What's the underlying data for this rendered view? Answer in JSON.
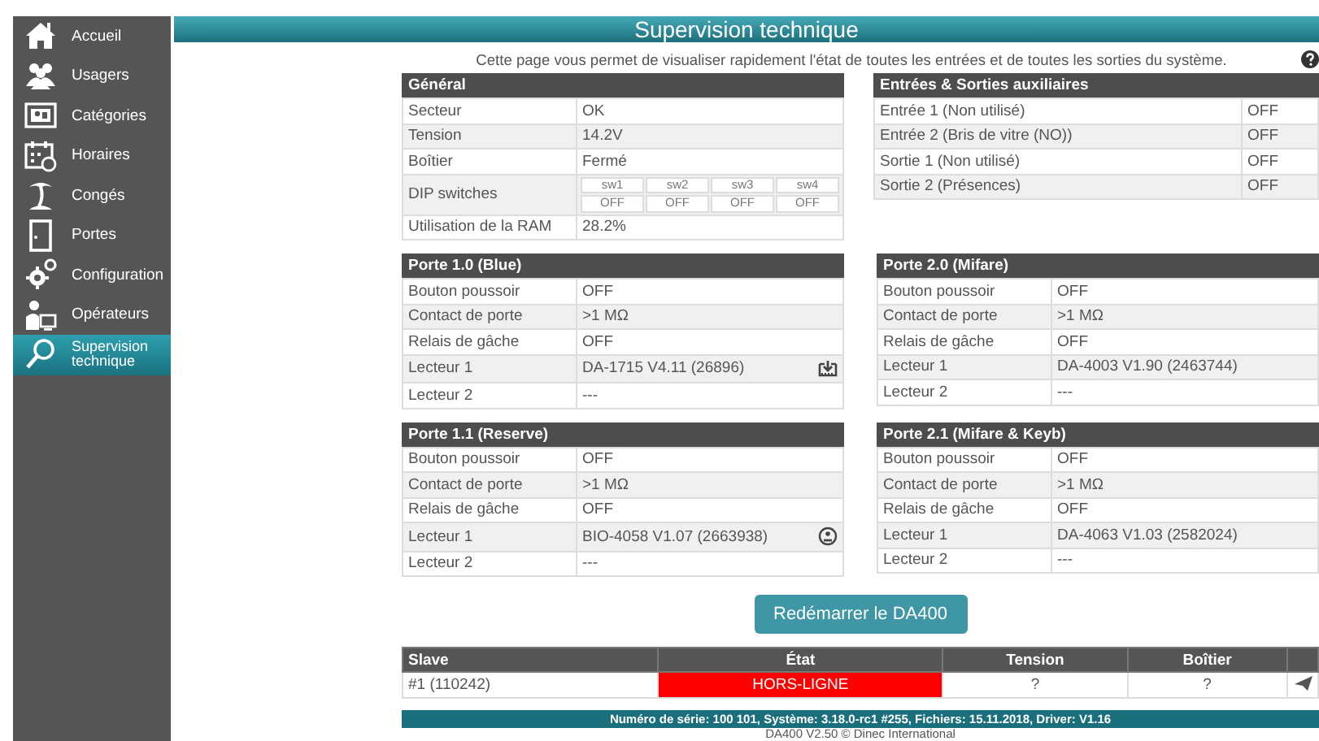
{
  "sidebar": {
    "items": [
      {
        "label": "Accueil",
        "selected": false
      },
      {
        "label": "Usagers",
        "selected": false
      },
      {
        "label": "Catégories",
        "selected": false
      },
      {
        "label": "Horaires",
        "selected": false
      },
      {
        "label": "Congés",
        "selected": false
      },
      {
        "label": "Portes",
        "selected": false
      },
      {
        "label": "Configuration",
        "selected": false
      },
      {
        "label": "Opérateurs",
        "selected": false
      },
      {
        "label": "Supervision technique",
        "selected": true
      }
    ]
  },
  "header": {
    "title": "Supervision technique"
  },
  "description": "Cette page vous permet de visualiser rapidement l'état de toutes les entrées et de toutes les sorties du système.",
  "panels": [
    {
      "title": "Général",
      "kind": "kv",
      "rows": [
        {
          "kind": "plain",
          "label": "Secteur",
          "value": "OK"
        },
        {
          "kind": "plain",
          "label": "Tension",
          "value": "14.2V"
        },
        {
          "kind": "plain",
          "label": "Boîtier",
          "value": "Fermé"
        },
        {
          "kind": "dip",
          "label": "DIP switches",
          "switches": [
            {
              "name": "sw1",
              "state": "OFF"
            },
            {
              "name": "sw2",
              "state": "OFF"
            },
            {
              "name": "sw3",
              "state": "OFF"
            },
            {
              "name": "sw4",
              "state": "OFF"
            }
          ]
        },
        {
          "kind": "plain",
          "label": "Utilisation de la RAM",
          "value": "28.2%"
        }
      ]
    },
    {
      "title": "Entrées & Sorties auxiliaires",
      "kind": "io",
      "rows": [
        {
          "kind": "plain",
          "label": "Entrée 1 (Non utilisé)",
          "value": "OFF"
        },
        {
          "kind": "plain",
          "label": "Entrée 2 (Bris de vitre (NO))",
          "value": "OFF"
        },
        {
          "kind": "plain",
          "label": "Sortie 1 (Non utilisé)",
          "value": "OFF"
        },
        {
          "kind": "plain",
          "label": "Sortie 2 (Présences)",
          "value": "OFF"
        }
      ]
    },
    {
      "title": "Porte 1.0 (Blue)",
      "kind": "kv",
      "rows": [
        {
          "kind": "plain",
          "label": "Bouton poussoir",
          "value": "OFF"
        },
        {
          "kind": "plain",
          "label": "Contact de porte",
          "value": ">1 MΩ"
        },
        {
          "kind": "plain",
          "label": "Relais de gâche",
          "value": "OFF"
        },
        {
          "kind": "download",
          "label": "Lecteur 1",
          "value": "DA-1715 V4.11 (26896)"
        },
        {
          "kind": "plain",
          "label": "Lecteur 2",
          "value": "---"
        }
      ]
    },
    {
      "title": "Porte 2.0 (Mifare)",
      "kind": "kv",
      "rows": [
        {
          "kind": "plain",
          "label": "Bouton poussoir",
          "value": "OFF"
        },
        {
          "kind": "plain",
          "label": "Contact de porte",
          "value": ">1 MΩ"
        },
        {
          "kind": "plain",
          "label": "Relais de gâche",
          "value": "OFF"
        },
        {
          "kind": "plain",
          "label": "Lecteur 1",
          "value": "DA-4003 V1.90 (2463744)"
        },
        {
          "kind": "plain",
          "label": "Lecteur 2",
          "value": "---"
        }
      ]
    },
    {
      "title": "Porte 1.1 (Reserve)",
      "kind": "kv",
      "rows": [
        {
          "kind": "plain",
          "label": "Bouton poussoir",
          "value": "OFF"
        },
        {
          "kind": "plain",
          "label": "Contact de porte",
          "value": ">1 MΩ"
        },
        {
          "kind": "plain",
          "label": "Relais de gâche",
          "value": "OFF"
        },
        {
          "kind": "enroll",
          "label": "Lecteur 1",
          "value": "BIO-4058 V1.07 (2663938)"
        },
        {
          "kind": "plain",
          "label": "Lecteur 2",
          "value": "---"
        }
      ]
    },
    {
      "title": "Porte 2.1 (Mifare & Keyb)",
      "kind": "kv",
      "rows": [
        {
          "kind": "plain",
          "label": "Bouton poussoir",
          "value": "OFF"
        },
        {
          "kind": "plain",
          "label": "Contact de porte",
          "value": ">1 MΩ"
        },
        {
          "kind": "plain",
          "label": "Relais de gâche",
          "value": "OFF"
        },
        {
          "kind": "plain",
          "label": "Lecteur 1",
          "value": "DA-4063 V1.03 (2582024)"
        },
        {
          "kind": "plain",
          "label": "Lecteur 2",
          "value": "---"
        }
      ]
    }
  ],
  "restart_button": "Redémarrer le DA400",
  "slaves": {
    "columns": [
      "Slave",
      "État",
      "Tension",
      "Boîtier"
    ],
    "rows": [
      {
        "slave": "#1 (110242)",
        "state": "HORS-LIGNE",
        "online": false,
        "tension": "?",
        "boitier": "?"
      }
    ]
  },
  "footer": {
    "serial": "Numéro de série: 100 101, Système: 3.18.0-rc1 #255, Fichiers: 15.11.2018, Driver: V1.16",
    "copyright": "DA400 V2.50 © Dinec International"
  }
}
